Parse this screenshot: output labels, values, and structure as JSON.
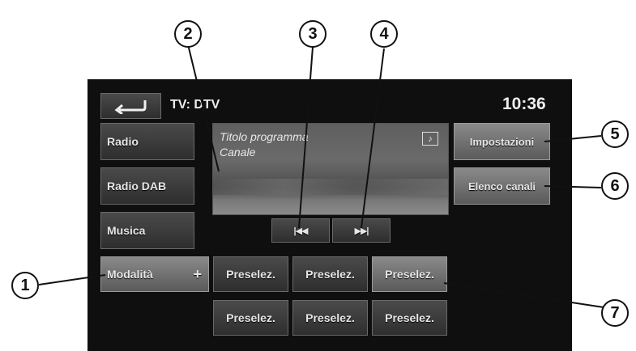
{
  "header": {
    "title": "TV: DTV",
    "clock": "10:36"
  },
  "sidebar": {
    "items": [
      {
        "label": "Radio"
      },
      {
        "label": "Radio DAB"
      },
      {
        "label": "Musica"
      }
    ],
    "mode_button": {
      "label": "Modalità",
      "plus": "+"
    }
  },
  "preview": {
    "program_title": "Titolo programma",
    "channel": "Canale",
    "icon": "music-note-icon"
  },
  "controls": {
    "prev_icon": "skip-previous-icon",
    "next_icon": "skip-next-icon"
  },
  "right_buttons": {
    "settings": "Impostazioni",
    "channel_list": "Elenco canali"
  },
  "presets": [
    [
      "Preselez.",
      "Preselez.",
      "Preselez."
    ],
    [
      "Preselez.",
      "Preselez.",
      "Preselez."
    ]
  ],
  "callouts": [
    "1",
    "2",
    "3",
    "4",
    "5",
    "6",
    "7"
  ]
}
